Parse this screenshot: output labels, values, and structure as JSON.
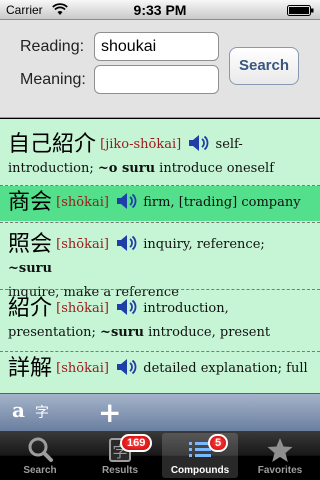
{
  "status_bar": {
    "carrier": "Carrier",
    "time": "9:33 PM"
  },
  "search_form": {
    "reading_label": "Reading:",
    "reading_value": "shoukai",
    "meaning_label": "Meaning:",
    "meaning_value": "",
    "search_button": "Search"
  },
  "results": [
    {
      "kanji": "自己紹介",
      "reading": "[jiko-shōkai]",
      "gloss_1": " self-",
      "gloss_2": "introduction; ",
      "bold_1": "~o suru",
      "gloss_3": " introduce oneself"
    },
    {
      "kanji": "商会",
      "reading": "[shōkai]",
      "gloss_1": " firm, [trading] company"
    },
    {
      "kanji": "照会",
      "reading": "[shōkai]",
      "gloss_1": " inquiry, reference; ",
      "bold_1": "~suru",
      "gloss_2": "inquire, make a reference"
    },
    {
      "kanji": "紹介",
      "reading": "[shōkai]",
      "gloss_1": " introduction,",
      "gloss_2": "presentation; ",
      "bold_1": "~suru",
      "gloss_3": " introduce, present"
    },
    {
      "kanji": "詳解",
      "reading": "[shōkai]",
      "gloss_1": " detailed explanation; full"
    }
  ],
  "toolbar": {
    "font_toggle_latin": "a",
    "font_toggle_kanji": "字",
    "add_label": "+"
  },
  "tabs": [
    {
      "label": "Search",
      "icon": "magnifier-icon"
    },
    {
      "label": "Results",
      "icon": "kanji-card-icon",
      "badge": "169"
    },
    {
      "label": "Compounds",
      "icon": "list-icon",
      "badge": "5"
    },
    {
      "label": "Favorites",
      "icon": "star-icon"
    }
  ],
  "colors": {
    "list_bg": "#c6f5d6",
    "selected_row": "#54df8c",
    "reading_text": "#9b1b1b"
  }
}
